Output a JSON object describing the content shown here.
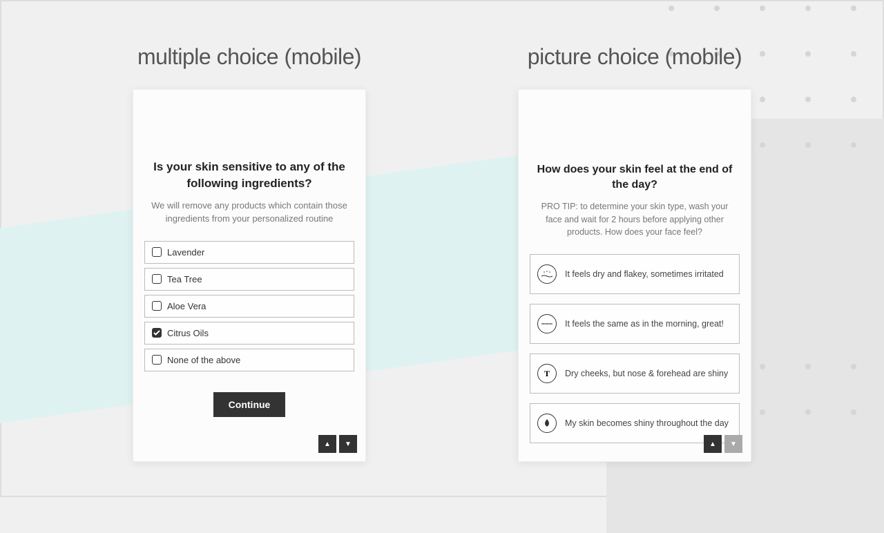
{
  "left": {
    "title": "multiple choice (mobile)",
    "question": "Is your skin sensitive to any of the following ingredients?",
    "subtext": "We will remove any products which contain those ingredients from your personalized routine",
    "options": [
      {
        "label": "Lavender",
        "checked": false
      },
      {
        "label": "Tea Tree",
        "checked": false
      },
      {
        "label": "Aloe Vera",
        "checked": false
      },
      {
        "label": "Citrus Oils",
        "checked": true
      },
      {
        "label": "None of the above",
        "checked": false
      }
    ],
    "continue": "Continue"
  },
  "right": {
    "title": "picture choice (mobile)",
    "question": "How does your skin feel at the end of the day?",
    "subtext": "PRO TIP: to determine your skin type, wash your face and wait for 2 hours before applying other products. How does your face feel?",
    "options": [
      {
        "label": "It feels dry and flakey, sometimes irritated",
        "icon": "dry-icon"
      },
      {
        "label": "It feels the same as in the morning, great!",
        "icon": "normal-icon"
      },
      {
        "label": "Dry cheeks, but nose & forehead are shiny",
        "icon": "combination-icon"
      },
      {
        "label": "My skin becomes shiny throughout the day",
        "icon": "oily-icon"
      }
    ]
  }
}
